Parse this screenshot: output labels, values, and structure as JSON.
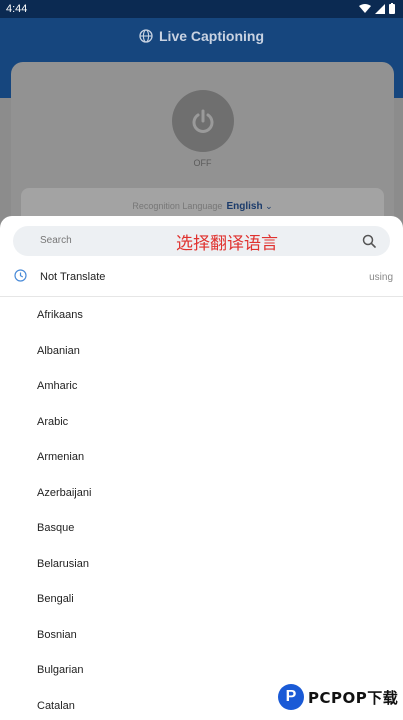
{
  "status_bar": {
    "time": "4:44"
  },
  "header": {
    "title": "Live Captioning",
    "icon": "globe-icon"
  },
  "main_card": {
    "power_state": "OFF",
    "recognition_label": "Recognition Language",
    "recognition_value": "English"
  },
  "sheet": {
    "search_placeholder": "Search",
    "overlay_text": "选择翻译语言",
    "current": {
      "label": "Not Translate",
      "status": "using"
    },
    "languages": [
      "Afrikaans",
      "Albanian",
      "Amharic",
      "Arabic",
      "Armenian",
      "Azerbaijani",
      "Basque",
      "Belarusian",
      "Bengali",
      "Bosnian",
      "Bulgarian",
      "Catalan"
    ]
  },
  "watermark": {
    "logo_letter": "P",
    "text": "PCPOP下载"
  },
  "colors": {
    "header": "#16467e",
    "accent": "#1b3b6b",
    "overlay_red": "#e0322f",
    "clock_blue": "#4a8bd8"
  }
}
